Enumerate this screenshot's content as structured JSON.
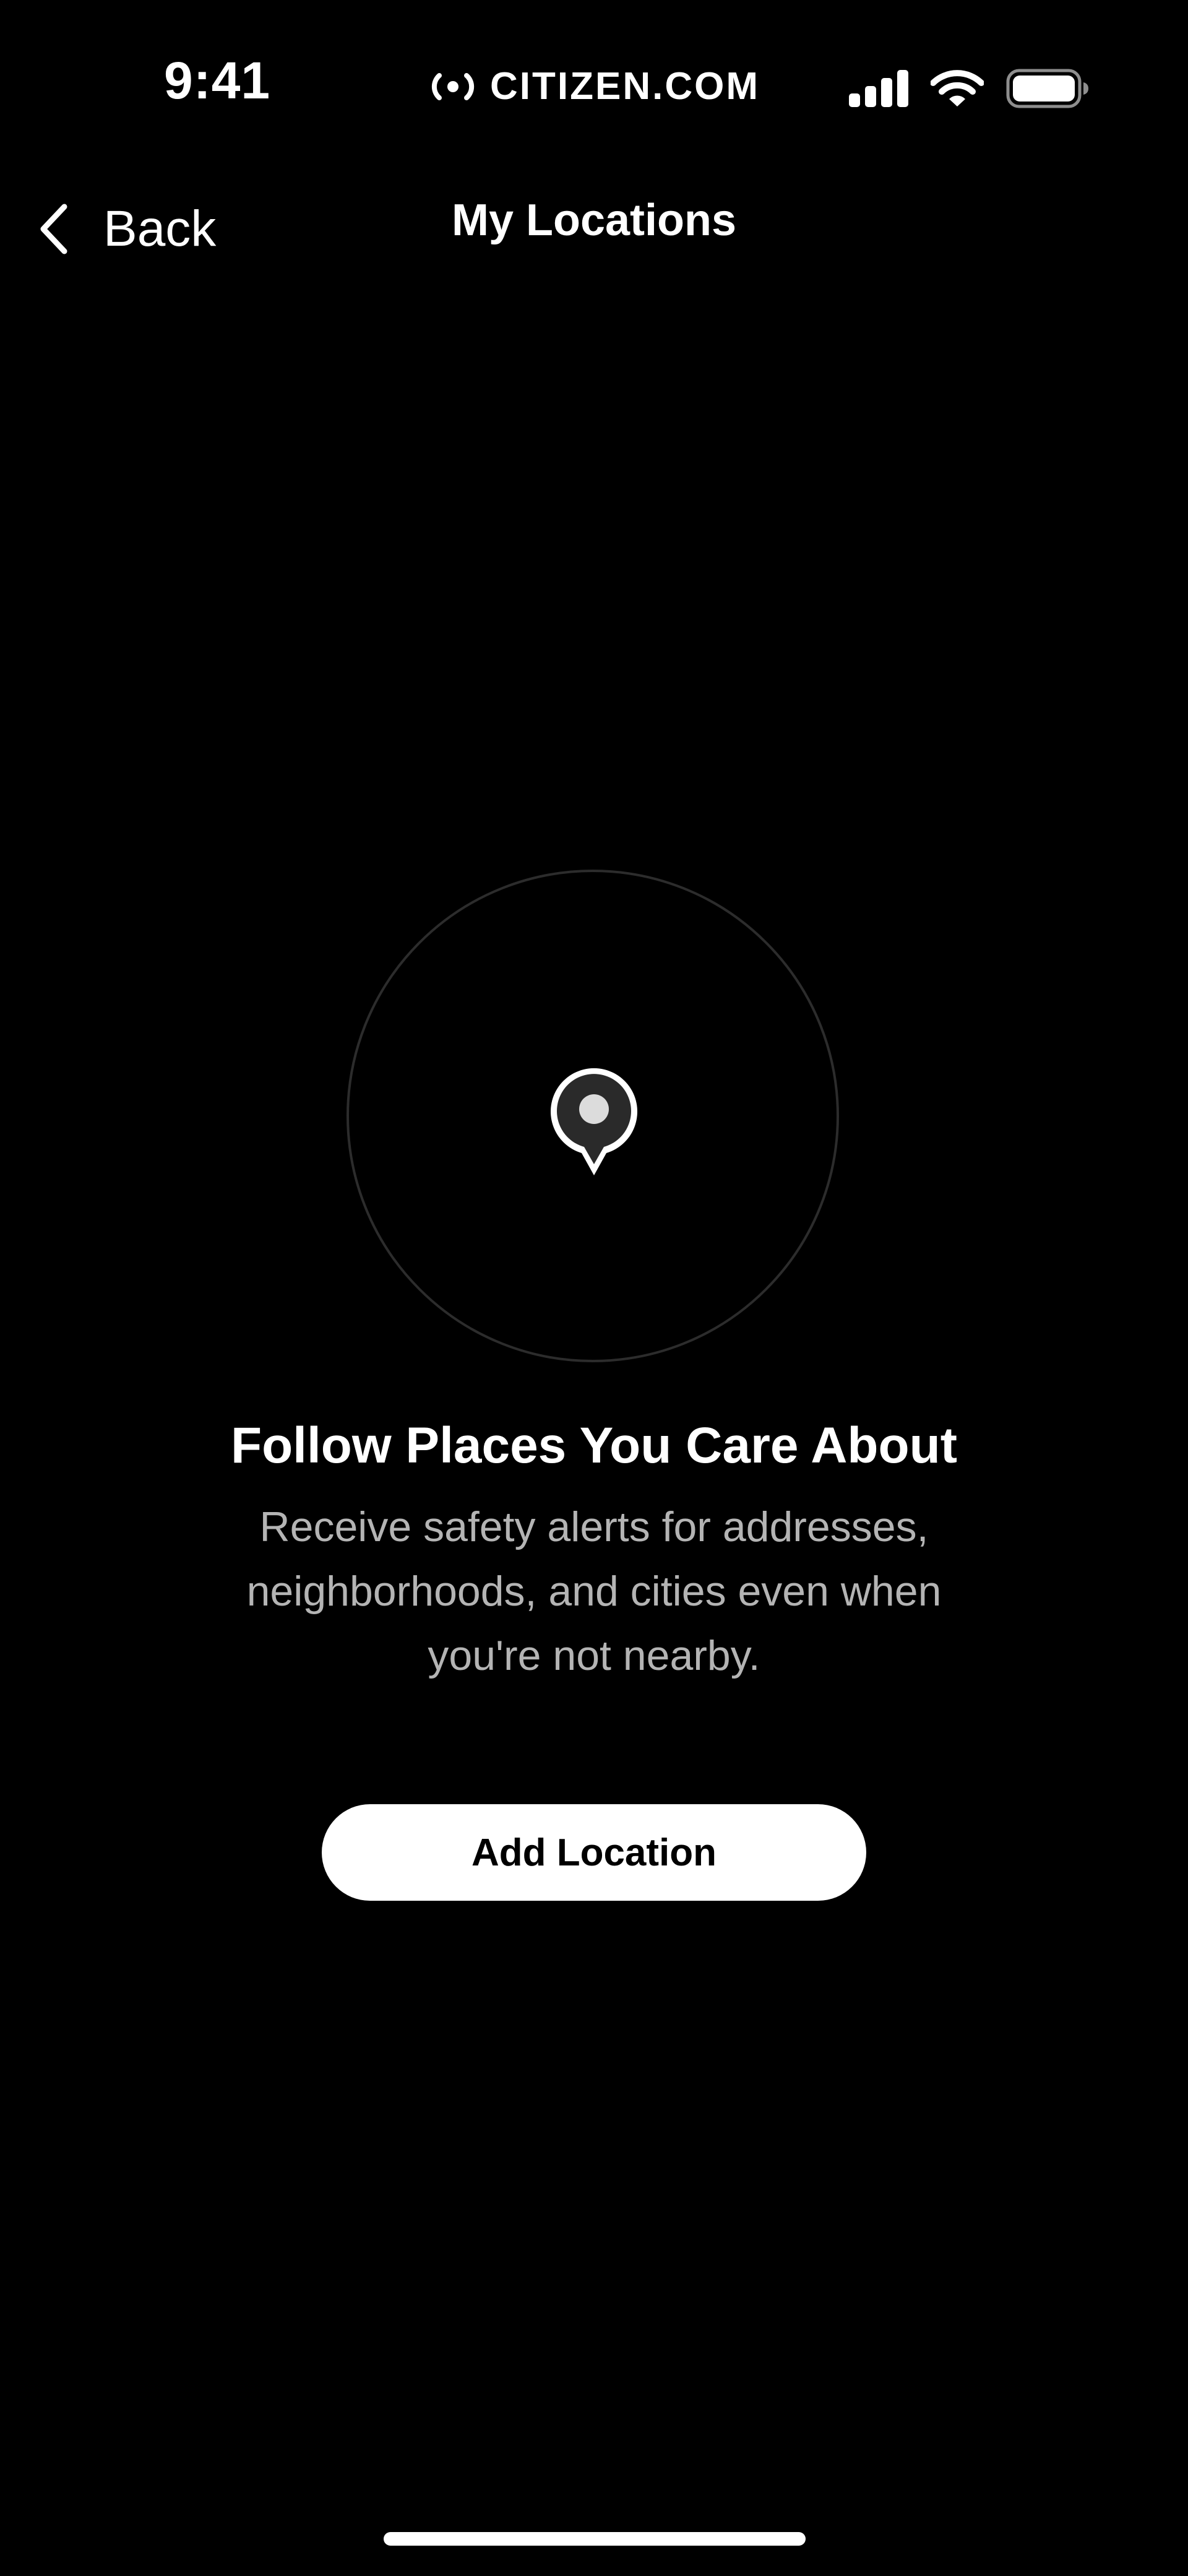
{
  "status_bar": {
    "time": "9:41",
    "brand": "CITIZEN.COM",
    "icons": [
      "signal-icon",
      "wifi-icon",
      "battery-icon"
    ]
  },
  "nav": {
    "back_label": "Back",
    "title": "My Locations"
  },
  "empty_state": {
    "icon": "location-pin-icon",
    "title": "Follow Places You Care About",
    "description": "Receive safety alerts for addresses, neighborhoods, and cities even when you're not nearby.",
    "button_label": "Add Location"
  },
  "colors": {
    "background": "#000000",
    "text_primary": "#ffffff",
    "text_secondary": "#b4b4b4",
    "ring": "#2c2c2c",
    "button_bg": "#ffffff",
    "button_text": "#000000"
  }
}
